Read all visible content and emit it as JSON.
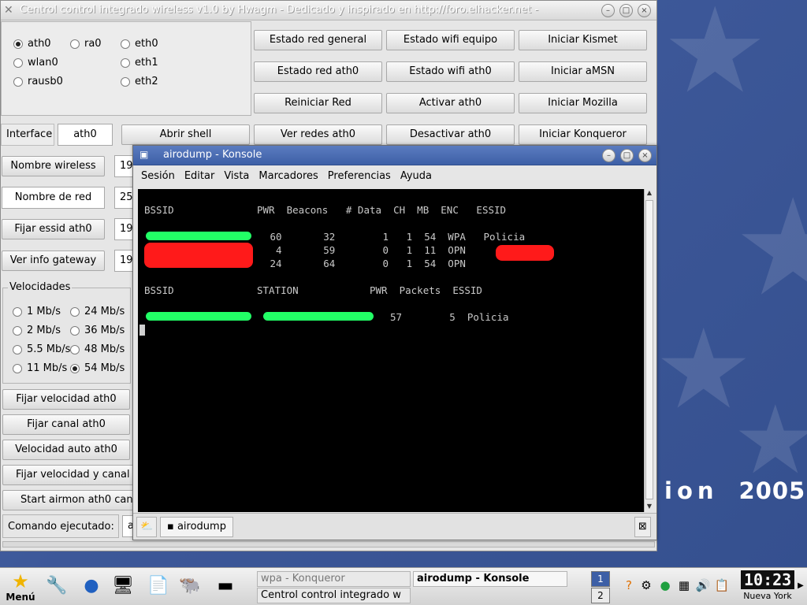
{
  "brand": {
    "word": "ion",
    "year": "2005"
  },
  "main_window": {
    "title": "Centrol control integrado wireless v1.0 by Hwagm - Dedicado y inspirado en http://foro.elhacker.net -",
    "interfaces": [
      {
        "label": "ath0",
        "selected": true
      },
      {
        "label": "ra0",
        "selected": false
      },
      {
        "label": "eth0",
        "selected": false
      },
      {
        "label": "wlan0",
        "selected": false
      },
      {
        "label": "eth1",
        "selected": false
      },
      {
        "label": "rausb0",
        "selected": false
      },
      {
        "label": "eth2",
        "selected": false
      }
    ],
    "buttons": {
      "estado_red_general": "Estado red general",
      "estado_wifi_equipo": "Estado wifi equipo",
      "iniciar_kismet": "Iniciar Kismet",
      "estado_red_ath0": "Estado red ath0",
      "estado_wifi_ath0": "Estado wifi ath0",
      "iniciar_amsn": "Iniciar aMSN",
      "reiniciar_red": "Reiniciar Red",
      "activar_ath0": "Activar ath0",
      "iniciar_mozilla": "Iniciar Mozilla",
      "abrir_shell": "Abrir shell",
      "ver_redes_ath0": "Ver redes ath0",
      "desactivar_ath0": "Desactivar ath0",
      "iniciar_konqueror": "Iniciar Konqueror",
      "nombre_wireless": "Nombre wireless",
      "fijar_essid_ath0": "Fijar essid ath0",
      "ver_info_gateway": "Ver info gateway",
      "fijar_velocidad_ath0": "Fijar velocidad ath0",
      "fijar_canal_ath0": "Fijar canal ath0",
      "velocidad_auto_ath0": "Velocidad auto ath0",
      "fijar_velocidad_y_canal": "Fijar velocidad y canal a",
      "start_airmon": "Start airmon ath0 cana"
    },
    "interface_label": "Interface",
    "interface_value": "ath0",
    "nombre_de_red_label": "Nombre de red",
    "field_values": [
      "19",
      "25",
      "19",
      "19"
    ],
    "speeds_title": "Velocidades",
    "speeds": [
      {
        "label": "1 Mb/s",
        "selected": false
      },
      {
        "label": "24 Mb/s",
        "selected": false
      },
      {
        "label": "2 Mb/s",
        "selected": false
      },
      {
        "label": "36 Mb/s",
        "selected": false
      },
      {
        "label": "5.5 Mb/s",
        "selected": false
      },
      {
        "label": "48 Mb/s",
        "selected": false
      },
      {
        "label": "11 Mb/s",
        "selected": false
      },
      {
        "label": "54 Mb/s",
        "selected": true
      }
    ],
    "comando_label": "Comando ejecutado:",
    "comando_value": "a"
  },
  "konsole": {
    "title": "airodump - Konsole",
    "menu": [
      "Sesión",
      "Editar",
      "Vista",
      "Marcadores",
      "Preferencias",
      "Ayuda"
    ],
    "ap_header": "BSSID              PWR  Beacons   # Data  CH  MB  ENC   ESSID",
    "ap_rows": [
      {
        "rest": " 60       32        1   1  54  WPA   Policia"
      },
      {
        "rest": "  4       59        0   1  11  OPN"
      },
      {
        "rest": " 24       64        0   1  54  OPN"
      }
    ],
    "sta_header": "BSSID              STATION            PWR  Packets  ESSID",
    "sta_rows": [
      {
        "rest": "57        5  Policia"
      }
    ],
    "tab_label": "airodump"
  },
  "taskbar": {
    "menu_label": "Menú",
    "tasks": [
      {
        "label": "wpa - Konqueror",
        "active": false
      },
      {
        "label": "airodump - Konsole",
        "active": true
      },
      {
        "label": "Centrol control integrado w",
        "active": false
      }
    ],
    "pager": [
      "1",
      "2"
    ],
    "clock_time": "10:23",
    "clock_city": "Nueva York"
  }
}
